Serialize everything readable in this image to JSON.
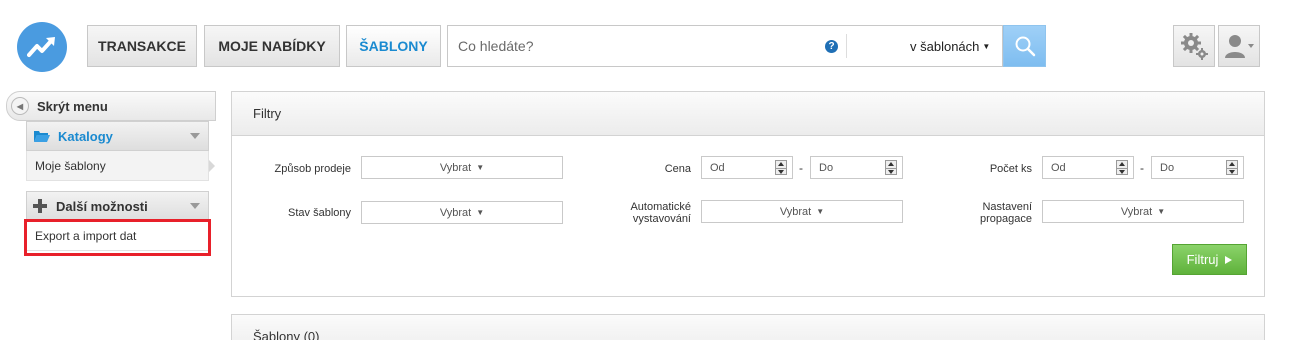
{
  "nav": {
    "logo_icon": "trend-up-icon",
    "tabs": [
      {
        "label": "TRANSAKCE",
        "active": false
      },
      {
        "label": "MOJE NABÍDKY",
        "active": false
      },
      {
        "label": "ŠABLONY",
        "active": true
      }
    ]
  },
  "search": {
    "placeholder": "Co hledáte?",
    "value": "",
    "help_icon": "?",
    "scope": "v šablonách"
  },
  "header_icons": {
    "settings": "gear-icon",
    "user": "user-icon"
  },
  "sidebar": {
    "hide_menu": "Skrýt menu",
    "sections": [
      {
        "title": "Katalogy",
        "icon": "folder-open-icon",
        "color": "#1a8ad0",
        "items": [
          "Moje šablony"
        ]
      },
      {
        "title": "Další možnosti",
        "icon": "plus-icon",
        "color": "#333333",
        "items": [
          "Export a import dat"
        ]
      }
    ]
  },
  "filters": {
    "title": "Filtry",
    "zpusob_prodeje": {
      "label": "Způsob prodeje",
      "value": "Vybrat"
    },
    "stav_sablony": {
      "label": "Stav šablony",
      "value": "Vybrat"
    },
    "cena": {
      "label": "Cena",
      "from_placeholder": "Od",
      "to_placeholder": "Do"
    },
    "automaticke": {
      "label_1": "Automatické",
      "label_2": "vystavování",
      "value": "Vybrat"
    },
    "pocet_ks": {
      "label": "Počet ks",
      "from_placeholder": "Od",
      "to_placeholder": "Do"
    },
    "propagace": {
      "label_1": "Nastavení",
      "label_2": "propagace",
      "value": "Vybrat"
    },
    "range_separator": "-",
    "submit": "Filtruj",
    "accent_color": "#5fb23b"
  },
  "templates_panel": {
    "title": "Šablony (0)"
  },
  "highlight_color": "#e8202a"
}
